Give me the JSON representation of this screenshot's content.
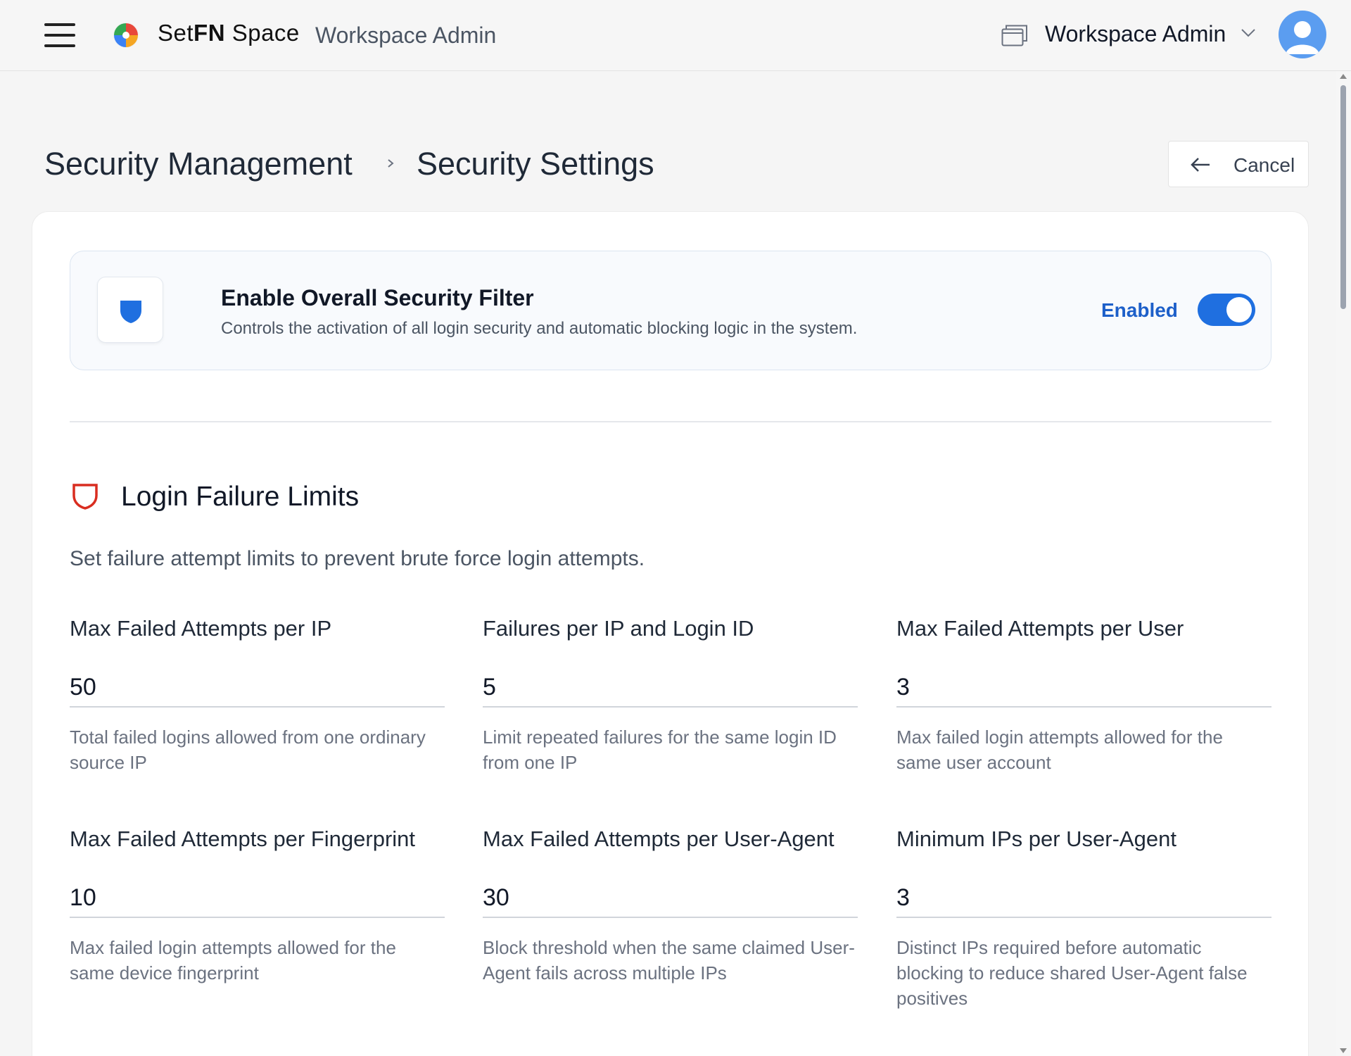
{
  "header": {
    "brand_prefix": "Set",
    "brand_fn": "FN",
    "brand_suffix": "Space",
    "subtitle": "Workspace Admin",
    "workspace_name": "Workspace Admin",
    "avatar_color": "#5b9df0"
  },
  "breadcrumb": {
    "parent": "Security Management",
    "current": "Security Settings"
  },
  "actions": {
    "cancel_label": "Cancel"
  },
  "security_filter": {
    "title": "Enable Overall Security Filter",
    "description": "Controls the activation of all login security and automatic blocking logic in the system.",
    "status_label": "Enabled",
    "enabled": true,
    "accent_color": "#1f6fe0"
  },
  "login_failure": {
    "title": "Login Failure Limits",
    "description": "Set failure attempt limits to prevent brute force login attempts.",
    "icon_color": "#d92d20",
    "fields": [
      {
        "label": "Max Failed Attempts per IP",
        "value": "50",
        "help": "Total failed logins allowed from one ordinary source IP"
      },
      {
        "label": "Failures per IP and Login ID",
        "value": "5",
        "help": "Limit repeated failures for the same login ID from one IP"
      },
      {
        "label": "Max Failed Attempts per User",
        "value": "3",
        "help": "Max failed login attempts allowed for the same user account"
      },
      {
        "label": "Max Failed Attempts per Fingerprint",
        "value": "10",
        "help": "Max failed login attempts allowed for the same device fingerprint"
      },
      {
        "label": "Max Failed Attempts per User-Agent",
        "value": "30",
        "help": "Block threshold when the same claimed User-Agent fails across multiple IPs"
      },
      {
        "label": "Minimum IPs per User-Agent",
        "value": "3",
        "help": "Distinct IPs required before automatic blocking to reduce shared User-Agent false positives"
      }
    ]
  }
}
